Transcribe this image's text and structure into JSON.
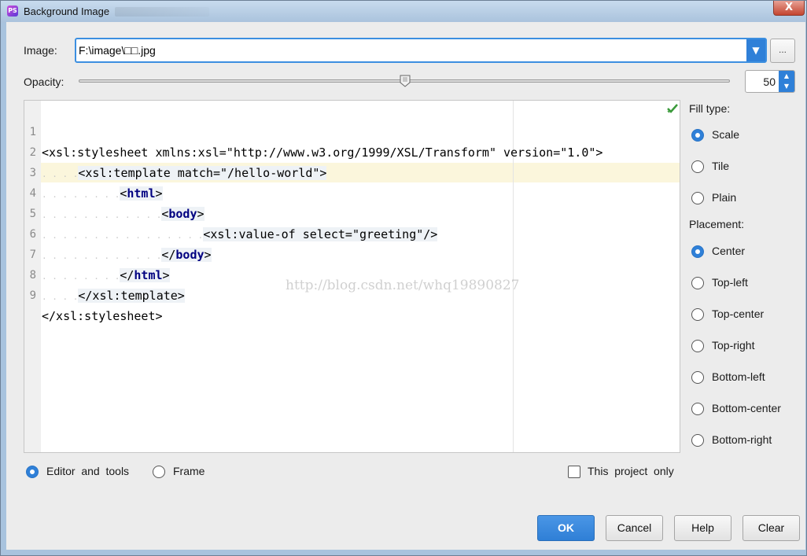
{
  "window": {
    "title": "Background Image",
    "close_glyph": "X"
  },
  "image": {
    "label": "Image:",
    "value": "F:\\image\\□□.jpg",
    "browse_label": "..."
  },
  "opacity": {
    "label": "Opacity:",
    "value": "50",
    "level_percent": 50
  },
  "editor": {
    "lines": [
      {
        "n": "1"
      },
      {
        "n": "2"
      },
      {
        "n": "3"
      },
      {
        "n": "4"
      },
      {
        "n": "5"
      },
      {
        "n": "6"
      },
      {
        "n": "7"
      },
      {
        "n": "8"
      },
      {
        "n": "9"
      }
    ],
    "code": {
      "l1": "<xsl:stylesheet xmlns:xsl=\"http://www.w3.org/1999/XSL/Transform\" version=\"1.0\">",
      "l2": "<xsl:template match=\"/hello-world\">",
      "l3_open": "<",
      "l3_tag": "html",
      "l3_close": ">",
      "l4_open": "<",
      "l4_tag": "body",
      "l4_close": ">",
      "l5": "<xsl:value-of select=\"greeting\"/>",
      "l6_open": "</",
      "l6_tag": "body",
      "l6_close": ">",
      "l7_open": "</",
      "l7_tag": "html",
      "l7_close": ">",
      "l8": "</xsl:template>",
      "l9": "</xsl:stylesheet>"
    },
    "watermark": "http://blog.csdn.net/whq19890827"
  },
  "fill_type": {
    "label": "Fill  type:",
    "options": [
      "Scale",
      "Tile",
      "Plain"
    ],
    "selected": "Scale"
  },
  "placement": {
    "label": "Placement:",
    "options": [
      "Center",
      "Top-left",
      "Top-center",
      "Top-right",
      "Bottom-left",
      "Bottom-center",
      "Bottom-right"
    ],
    "selected": "Center"
  },
  "target": {
    "options": [
      "Editor  and  tools",
      "Frame"
    ],
    "selected": "Editor  and  tools"
  },
  "this_project_only": {
    "label": "This  project  only",
    "checked": false
  },
  "buttons": {
    "ok": "OK",
    "cancel": "Cancel",
    "help": "Help",
    "clear": "Clear"
  },
  "colors": {
    "accent": "#2f80d8",
    "title_bar": "#a9c2dc",
    "keyword": "#000080"
  }
}
